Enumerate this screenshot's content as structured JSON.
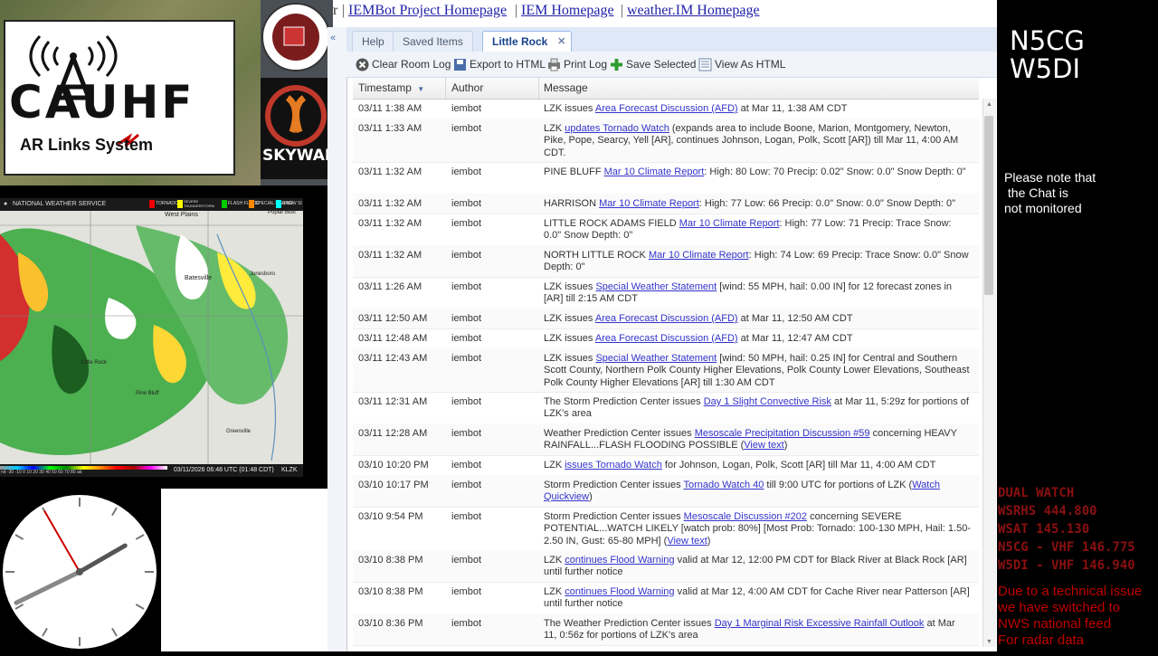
{
  "logos": {
    "cauhf": "CAUHF",
    "arn": "AR  Links System",
    "skywarn": "SKYWARN"
  },
  "radar": {
    "header": "NATIONAL WEATHER SERVICE",
    "legend": [
      "TORNADO",
      "SEVERE THUNDERSTORM",
      "FLASH FLOOD",
      "SPECIAL MARINE",
      "SNOW SQUALL"
    ],
    "places": [
      "West Plains",
      "Poplar Bluff",
      "Batesville",
      "Jonesboro",
      "Little Rock",
      "Pine Bluff",
      "Greenville"
    ],
    "timestamp": "03/11/2026 06:48 UTC (01:48 CDT)",
    "site": "KLZK",
    "scale": "nd -30 -10 0 10 20 30 40 50 60 70 80 ab"
  },
  "clock": {
    "hour_deg": 60,
    "minute_deg": 244,
    "second_deg": 330
  },
  "topbar": {
    "lead": "r",
    "links": [
      "IEMBot Project Homepage",
      "IEM Homepage",
      "weather.IM Homepage"
    ],
    "separator": "|"
  },
  "tabs": [
    {
      "label": "Help"
    },
    {
      "label": "Saved Items"
    },
    {
      "label": "Little Rock"
    }
  ],
  "toolbar": {
    "clear": "Clear Room Log",
    "export": "Export to HTML",
    "print": "Print Log",
    "save": "Save Selected",
    "view": "View As HTML"
  },
  "grid": {
    "headers": {
      "timestamp": "Timestamp",
      "author": "Author",
      "message": "Message"
    },
    "rows": [
      {
        "ts": "03/11 1:38 AM",
        "au": "iembot",
        "pre": "LZK issues ",
        "link": "Area Forecast Discussion (AFD)",
        "post": " at Mar 11, 1:38 AM CDT"
      },
      {
        "ts": "03/11 1:33 AM",
        "au": "iembot",
        "pre": "LZK ",
        "link": "updates Tornado Watch",
        "post": " (expands area to include Boone, Marion, Montgomery, Newton, Pike, Pope, Searcy, Yell [AR], continues Johnson, Logan, Polk, Scott [AR]) till Mar 11, 4:00 AM CDT."
      },
      {
        "ts": "03/11 1:32 AM",
        "au": "iembot",
        "pre": "PINE BLUFF ",
        "link": "Mar 10 Climate Report",
        "post": ": High: 80 Low: 70 Precip: 0.02\" Snow: 0.0\" Snow Depth: 0\""
      },
      {
        "ts": "03/11 1:32 AM",
        "au": "iembot",
        "pre": "HARRISON ",
        "link": "Mar 10 Climate Report",
        "post": ": High: 77 Low: 66 Precip: 0.0\" Snow: 0.0\" Snow Depth: 0\""
      },
      {
        "ts": "03/11 1:32 AM",
        "au": "iembot",
        "pre": "LITTLE ROCK ADAMS FIELD ",
        "link": "Mar 10 Climate Report",
        "post": ": High: 77 Low: 71 Precip: Trace Snow: 0.0\" Snow Depth: 0\""
      },
      {
        "ts": "03/11 1:32 AM",
        "au": "iembot",
        "pre": "NORTH LITTLE ROCK ",
        "link": "Mar 10 Climate Report",
        "post": ": High: 74 Low: 69 Precip: Trace Snow: 0.0\" Snow Depth: 0\""
      },
      {
        "ts": "03/11 1:26 AM",
        "au": "iembot",
        "pre": "LZK issues ",
        "link": "Special Weather Statement",
        "post": " [wind: 55 MPH, hail: 0.00 IN] for 12 forecast zones in [AR] till 2:15 AM CDT"
      },
      {
        "ts": "03/11 12:50 AM",
        "au": "iembot",
        "pre": "LZK issues ",
        "link": "Area Forecast Discussion (AFD)",
        "post": " at Mar 11, 12:50 AM CDT"
      },
      {
        "ts": "03/11 12:48 AM",
        "au": "iembot",
        "pre": "LZK issues ",
        "link": "Area Forecast Discussion (AFD)",
        "post": " at Mar 11, 12:47 AM CDT"
      },
      {
        "ts": "03/11 12:43 AM",
        "au": "iembot",
        "pre": "LZK issues ",
        "link": "Special Weather Statement",
        "post": " [wind: 50 MPH, hail: 0.25 IN] for Central and Southern Scott County, Northern Polk County Higher Elevations, Polk County Lower Elevations, Southeast Polk County Higher Elevations [AR] till 1:30 AM CDT"
      },
      {
        "ts": "03/11 12:31 AM",
        "au": "iembot",
        "pre": "The Storm Prediction Center issues ",
        "link": "Day 1 Slight Convective Risk",
        "post": " at Mar 11, 5:29z for portions of LZK's area"
      },
      {
        "ts": "03/11 12:28 AM",
        "au": "iembot",
        "pre": "Weather Prediction Center issues ",
        "link": "Mesoscale Precipitation Discussion #59",
        "post": " concerning HEAVY RAINFALL...FLASH FLOODING POSSIBLE (",
        "link2": "View text",
        "post2": ")"
      },
      {
        "ts": "03/10 10:20 PM",
        "au": "iembot",
        "pre": "LZK ",
        "link": "issues Tornado Watch",
        "post": " for Johnson, Logan, Polk, Scott [AR] till Mar 11, 4:00 AM CDT"
      },
      {
        "ts": "03/10 10:17 PM",
        "au": "iembot",
        "pre": "Storm Prediction Center issues ",
        "link": "Tornado Watch 40",
        "post": " till 9:00 UTC for portions of LZK (",
        "link2": "Watch Quickview",
        "post2": ")"
      },
      {
        "ts": "03/10 9:54 PM",
        "au": "iembot",
        "pre": "Storm Prediction Center issues ",
        "link": "Mesoscale Discussion #202",
        "post": " concerning SEVERE POTENTIAL...WATCH LIKELY [watch prob: 80%] [Most Prob: Tornado: 100-130 MPH, Hail: 1.50-2.50 IN, Gust: 65-80 MPH] (",
        "link2": "View text",
        "post2": ")"
      },
      {
        "ts": "03/10 8:38 PM",
        "au": "iembot",
        "pre": "LZK ",
        "link": "continues Flood Warning",
        "post": " valid at Mar 12, 12:00 PM CDT for Black River at Black Rock [AR] until further notice"
      },
      {
        "ts": "03/10 8:38 PM",
        "au": "iembot",
        "pre": "LZK ",
        "link": "continues Flood Warning",
        "post": " valid at Mar 12, 4:00 AM CDT for Cache River near Patterson [AR] until further notice"
      },
      {
        "ts": "03/10 8:36 PM",
        "au": "iembot",
        "pre": "The Weather Prediction Center issues ",
        "link": "Day 1 Marginal Risk Excessive Rainfall Outlook",
        "post": " at Mar 11, 0:56z for portions of LZK's area"
      }
    ]
  },
  "right": {
    "callsign1": "N5CG",
    "callsign2": "W5DI",
    "note": "Please note that\n the Chat is\nnot monitored",
    "dual_watch": "DUAL WATCH\nWSRHS 444.800\nWSAT 145.130\nN5CG - VHF 146.775\nW5DI - VHF 146.940",
    "issue": "Due to a technical issue\nwe have switched to\nNWS national feed\nFor radar data"
  }
}
